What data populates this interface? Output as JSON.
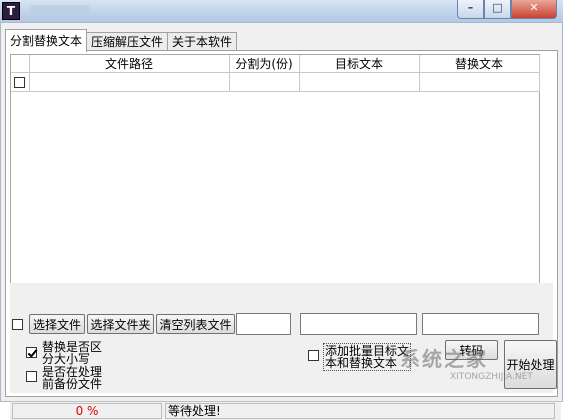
{
  "window": {
    "icon_letter": "T",
    "controls": {
      "minimize": "–",
      "maximize": "□",
      "close": "✕"
    }
  },
  "tabs": [
    {
      "label": "分割替换文本",
      "active": true
    },
    {
      "label": "压缩解压文件",
      "active": false
    },
    {
      "label": "关于本软件",
      "active": false
    }
  ],
  "grid": {
    "columns": [
      "",
      "文件路径",
      "分割为(份)",
      "目标文本",
      "替换文本"
    ],
    "rows": [
      {
        "checked": false,
        "path": "",
        "split": "",
        "target": "",
        "replace": ""
      }
    ]
  },
  "toolbar": {
    "select_all_checked": false,
    "select_file": "选择文件",
    "select_folder": "选择文件夹",
    "clear_list": "清空列表文件",
    "split_value": "",
    "target_text": "",
    "replace_text": ""
  },
  "options": {
    "case_sensitive": {
      "label_line1": "替换是否区",
      "label_line2": "分大小写",
      "checked": true
    },
    "backup": {
      "label_line1": "是否在处理",
      "label_line2": "前备份文件",
      "checked": false
    },
    "batch_add": {
      "label_line1": "添加批量目标文",
      "label_line2": "本和替换文本",
      "checked": false
    }
  },
  "buttons": {
    "transcode": "转码",
    "start": "开始处理"
  },
  "status": {
    "progress_text": "0 %",
    "progress": 0,
    "message": "等待处理!"
  },
  "watermark": {
    "text": "系统之家",
    "sub": "XITONGZHIJIA.NET"
  }
}
